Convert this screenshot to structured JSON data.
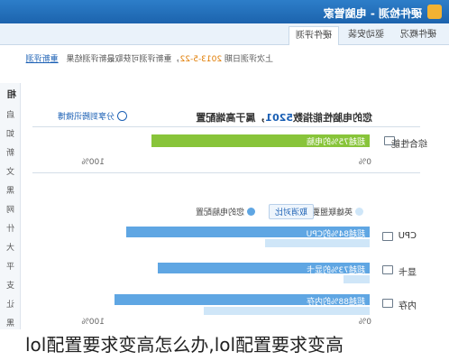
{
  "window": {
    "title": "硬件检测 - 电脑管家"
  },
  "tabs": [
    {
      "label": "硬件概况"
    },
    {
      "label": "驱动安装"
    },
    {
      "label": "硬件评测"
    }
  ],
  "notice": {
    "prefix": "上次评测日期",
    "date": "2013-5-22",
    "text": "，重新评测可获取最新评测结果",
    "link": "重新评测"
  },
  "sidebar": {
    "heading": "相",
    "items": [
      "启",
      "如",
      "新",
      "文",
      "黑",
      "网",
      "什",
      "大",
      "平",
      "支",
      "让",
      "黑"
    ]
  },
  "summary": {
    "headline_prefix": "您的电脑性能指数",
    "score": "5201",
    "headline_suffix": "，属于高端配置",
    "share_label": "分享到腾讯微博",
    "overall_label": "综合性能",
    "overall_bar_text": "超越75%的电脑",
    "overall_value": 0.75,
    "axis_left": "0%",
    "axis_right": "100%"
  },
  "legend": {
    "item1": "英雄联盟要求配置",
    "item2": "您的电脑配置",
    "compare_button": "取消对比"
  },
  "rows": [
    {
      "label": "CPU",
      "bar_text": "超越84%的CPU",
      "value": 0.84,
      "required": 0.36
    },
    {
      "label": "显卡",
      "bar_text": "超越73%的显卡",
      "value": 0.73,
      "required": 0.09
    },
    {
      "label": "内存",
      "bar_text": "超越88%的内存",
      "value": 0.88,
      "required": 0.57
    }
  ],
  "bottom_axis": {
    "left": "0%",
    "right": "100%"
  },
  "colors": {
    "overall_bar": "#88c43a",
    "user_bar": "#5fa6e3",
    "required_bar": "#cfe6f8",
    "title_bar": "#1c63ad"
  },
  "caption": "lol配置要求变高怎么办,lol配置要求变高"
}
